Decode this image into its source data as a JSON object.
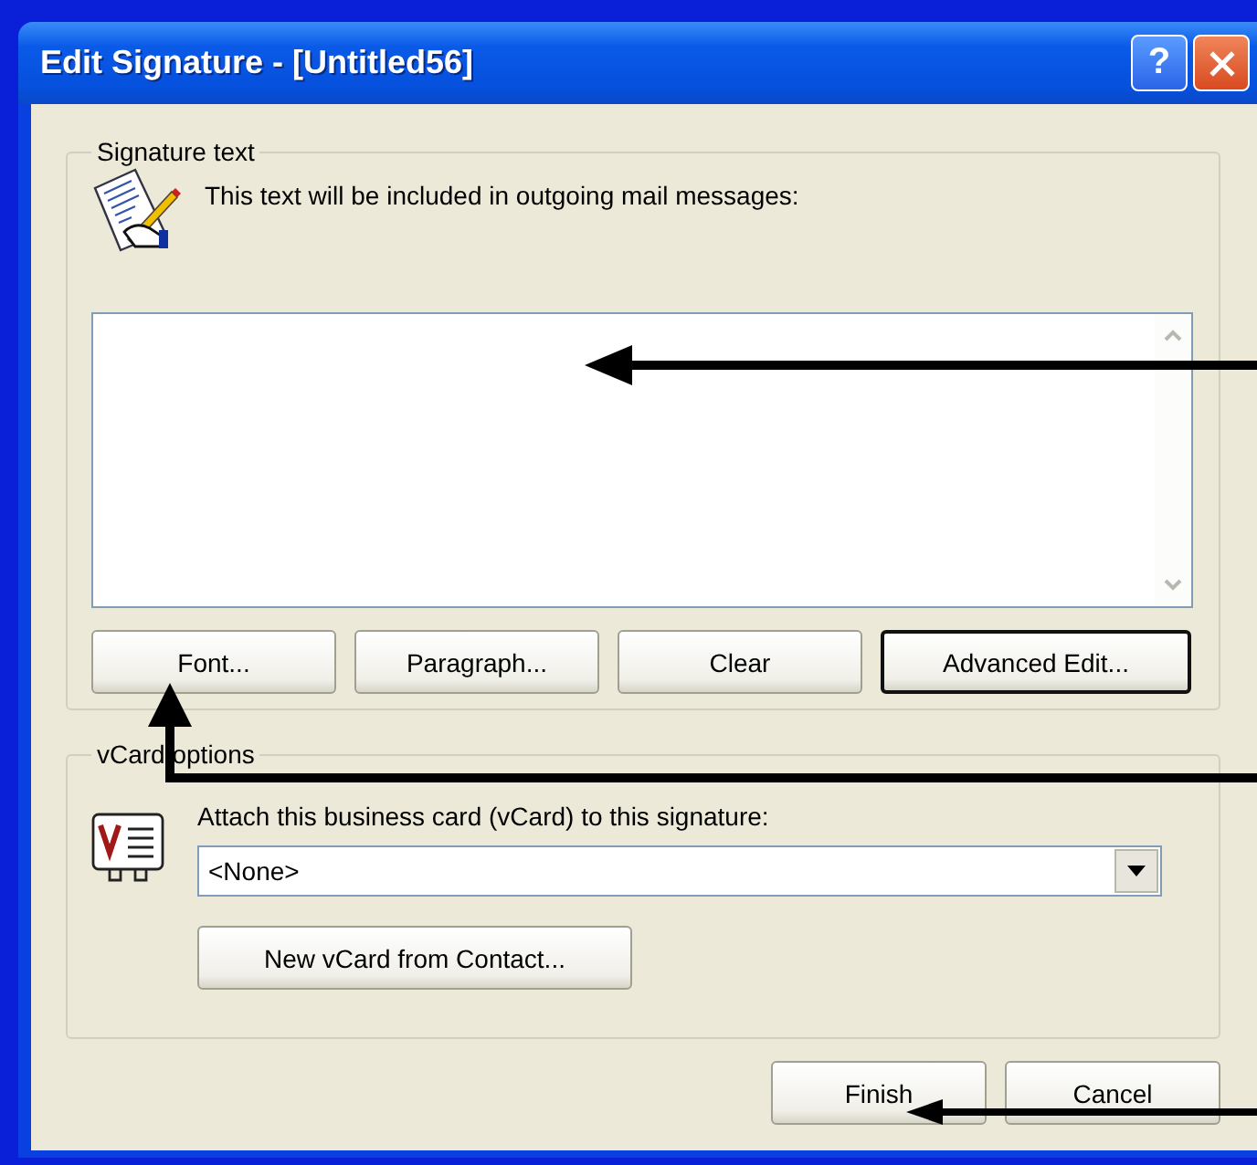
{
  "window": {
    "title": "Edit Signature - [Untitled56]",
    "help_button": "?"
  },
  "signature_group": {
    "legend": "Signature text",
    "description": "This text will be included in outgoing mail messages:",
    "buttons": [
      {
        "label": "Font...",
        "default": false
      },
      {
        "label": "Paragraph...",
        "default": false
      },
      {
        "label": "Clear",
        "default": false
      },
      {
        "label": "Advanced Edit...",
        "default": true
      }
    ]
  },
  "vcard_group": {
    "legend": "vCard options",
    "attach_label": "Attach this business card (vCard) to this signature:",
    "dropdown": {
      "value": "<None>"
    },
    "new_button": "New vCard from Contact..."
  },
  "buttons": [
    "Finish",
    "Cancel"
  ]
}
